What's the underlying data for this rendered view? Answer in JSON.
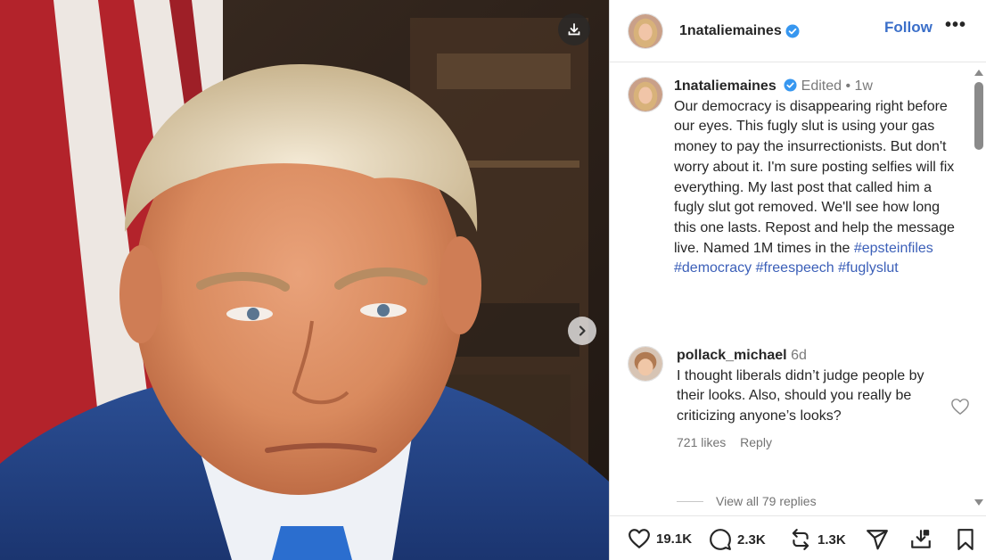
{
  "post": {
    "username": "1nataliemaines",
    "follow_label": "Follow",
    "more_label": "•••"
  },
  "caption": {
    "username": "1nataliemaines",
    "meta": "Edited • 1w",
    "text": "Our democracy is disappearing right before our eyes. This fugly slut is using your gas money to pay the insurrectionists. But don't worry about it. I'm sure posting selfies will fix everything. My last post that called him a fugly slut got removed.  We'll see how long this one lasts. Repost and help the message live. Named 1M times in the",
    "hashtags": [
      "#epsteinfiles",
      "#democracy",
      "#freespeech",
      "#fuglyslut"
    ]
  },
  "comment": {
    "username": "pollack_michael",
    "time": "6d",
    "text": "I thought liberals didn’t judge people by their looks. Also, should you really be criticizing anyone’s looks?",
    "likes": "721 likes",
    "reply_label": "Reply",
    "view_replies": "View all 79 replies"
  },
  "actions": {
    "likes": "19.1K",
    "comments": "2.3K",
    "reposts": "1.3K"
  },
  "icons": {
    "download": "download-icon",
    "next": "chevron-right-icon",
    "verified": "verified-badge-icon",
    "heart": "heart-icon",
    "comment": "comment-icon",
    "repost": "repost-icon",
    "share": "share-icon",
    "save_download": "save-to-device-icon",
    "bookmark": "bookmark-icon"
  },
  "colors": {
    "accent": "#3b6fc9",
    "verified": "#3797f0",
    "hashtag": "#3b5fb8"
  }
}
